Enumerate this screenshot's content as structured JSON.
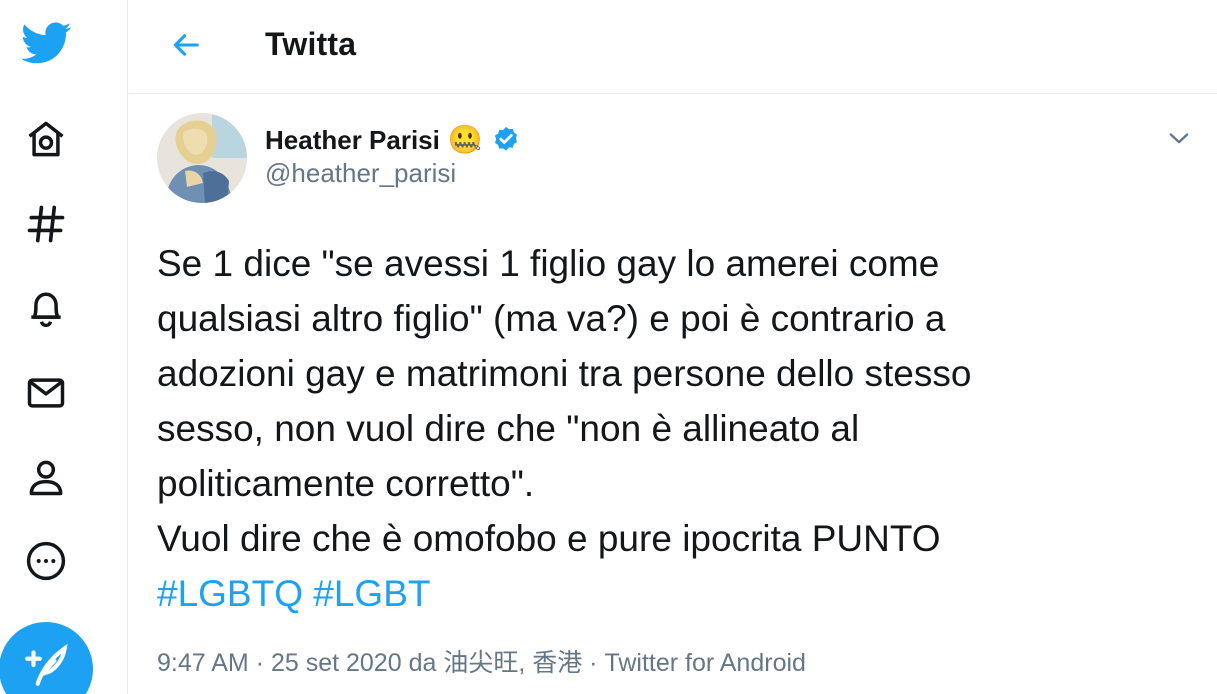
{
  "header": {
    "title": "Twitta"
  },
  "tweet": {
    "author": {
      "name": "Heather Parisi",
      "name_emoji": "🤐",
      "handle": "@heather_parisi",
      "verified": true
    },
    "text_lines": [
      "Se 1 dice \"se avessi 1 figlio gay lo amerei come",
      "qualsiasi altro figlio\" (ma va?) e poi è contrario a",
      "adozioni gay e matrimoni tra persone dello stesso",
      "sesso, non vuol dire che \"non è allineato al",
      "politicamente corretto\".",
      "Vuol dire che è omofobo e pure ipocrita PUNTO"
    ],
    "hashtags": [
      "#LGBTQ",
      "#LGBT"
    ],
    "meta": {
      "time": "9:47 AM",
      "separator": " · ",
      "date_prefix": "25 set 2020 da ",
      "location": "油尖旺, 香港",
      "source": "Twitter for Android"
    }
  },
  "icons": {
    "logo": "twitter-bird-icon",
    "home": "home-icon",
    "explore": "hashtag-icon",
    "notifications": "bell-icon",
    "messages": "envelope-icon",
    "profile": "person-icon",
    "more": "more-circle-icon",
    "compose": "compose-feather-icon",
    "back": "arrow-left-icon",
    "caret": "chevron-down-icon",
    "verified": "verified-badge-icon"
  },
  "colors": {
    "accent": "#1da1f2",
    "text": "#14171a",
    "secondary": "#657786",
    "border": "#e6ecf0"
  }
}
